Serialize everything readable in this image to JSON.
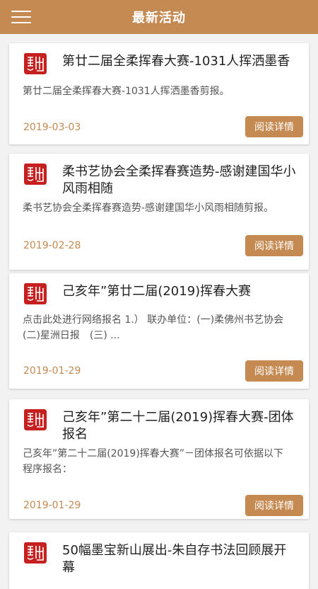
{
  "header": {
    "title": "最新活动",
    "menu_icon": "hamburger-icon"
  },
  "colors": {
    "accent": "#c48a52",
    "seal_red": "#c51f1f",
    "background": "#f3f2f2"
  },
  "articles": [
    {
      "title": "第廿二届全柔挥春大赛-1031人挥洒墨香",
      "desc": "第廿二届全柔挥春大赛-1031人挥洒墨香剪报。",
      "date": "2019-03-03",
      "button": "阅读详情"
    },
    {
      "title": "柔书艺协会全柔挥春赛造势-感谢建国华小风雨相随",
      "desc": "柔书艺协会全柔挥春赛造势-感谢建国华小风雨相随剪报。",
      "date": "2019-02-28",
      "button": "阅读详情"
    },
    {
      "title": "己亥年”第廿二届(2019)挥春大赛",
      "desc": "点击此处进行网络报名 1.） 联办单位：(一)柔佛州书艺协会　(二)星洲日报　(三) ...",
      "date": "2019-01-29",
      "button": "阅读详情"
    },
    {
      "title": "己亥年”第二十二届(2019)挥春大赛-团体报名",
      "desc": "己亥年”第二十二届(2019)挥春大赛”－团体报名可依据以下程序报名：",
      "date": "2019-01-29",
      "button": "阅读详情"
    },
    {
      "title": "50幅墨宝新山展出-朱自存书法回顾展开幕",
      "desc": "",
      "date": "",
      "button": ""
    }
  ]
}
